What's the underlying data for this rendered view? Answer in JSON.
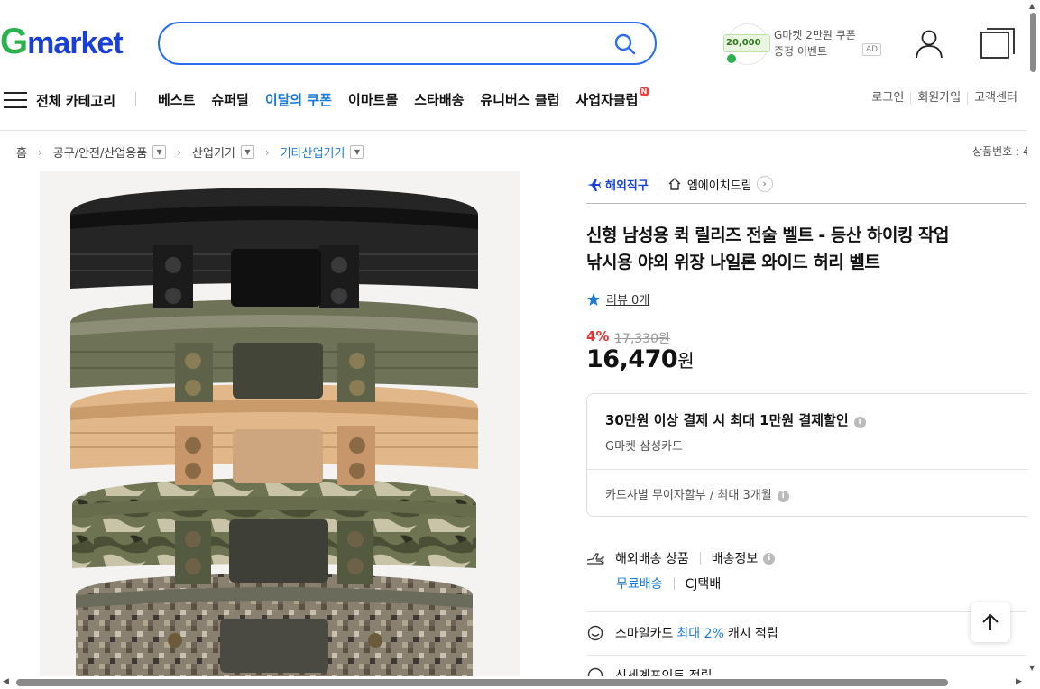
{
  "header": {
    "logo_g": "G",
    "logo_rest": "market",
    "search_placeholder": "",
    "coupon_chip": "20,000",
    "coupon_line1": "G마켓 2만원 쿠폰",
    "coupon_line2": "증정 이벤트",
    "ad_label": "AD",
    "brand_color": "#1a3fd6",
    "accent_color": "#2c6df0"
  },
  "nav": {
    "all_categories": "전체 카테고리",
    "items": [
      "베스트",
      "슈퍼딜",
      "이달의 쿠폰",
      "이마트몰",
      "스타배송",
      "유니버스 클럽",
      "사업자클럽"
    ],
    "new_badge": "N",
    "right": [
      "로그인",
      "회원가입",
      "고객센터"
    ]
  },
  "breadcrumb": {
    "home": "홈",
    "c1": "공구/안전/산업용품",
    "c2": "산업기기",
    "c3": "기타산업기기",
    "product_no": "상품번호 : 4"
  },
  "product": {
    "overseas_label": "해외직구",
    "seller": "엠에이치드림",
    "title_line1": "신형 남성용 퀵 릴리즈 전술 벨트 - 등산 하이킹 작업",
    "title_line2": "낚시용 야외 위장 나일론 와이드 허리 벨트",
    "review": "리뷰 0개",
    "discount": "4%",
    "original_price": "17,330원",
    "price": "16,470",
    "price_unit": "원"
  },
  "card_benefit": {
    "headline": "30만원 이상 결제 시 최대 1만원 결제할인",
    "card_name": "G마켓 삼성카드",
    "installment": "카드사별 무이자할부 / 최대 3개월"
  },
  "shipping": {
    "overseas": "해외배송 상품",
    "info": "배송정보",
    "free": "무료배송",
    "carrier": "CJ택배"
  },
  "smile": {
    "prefix": "스마일카드",
    "highlight": "최대 2%",
    "suffix": "캐시 적립"
  },
  "shinsegae": "신세계포인트 적립"
}
